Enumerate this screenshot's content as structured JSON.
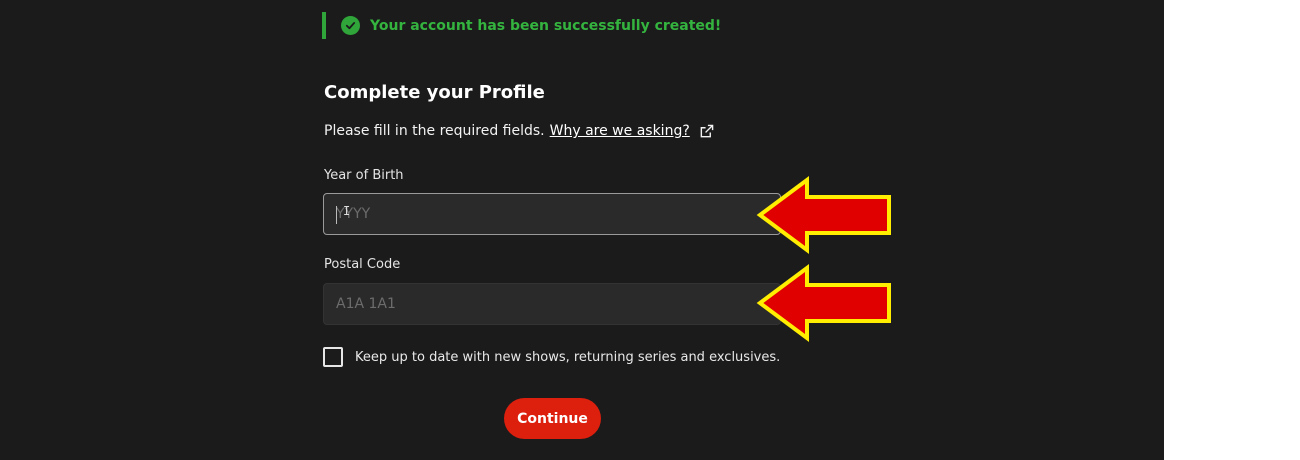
{
  "banner": {
    "text": "Your account has been successfully created!",
    "icon": "check-circle-icon",
    "color": "#2fa53a"
  },
  "form": {
    "title": "Complete your Profile",
    "subtitle": "Please fill in the required fields.",
    "help_link": "Why are we asking?",
    "year_label": "Year of Birth",
    "year_placeholder": "YYYY",
    "year_value": "",
    "postal_label": "Postal Code",
    "postal_placeholder": "A1A 1A1",
    "postal_value": "",
    "newsletter_label": "Keep up to date with new shows, returning series and exclusives.",
    "newsletter_checked": false,
    "continue_label": "Continue"
  },
  "colors": {
    "accent": "#dd1f0e",
    "success": "#2fa53a",
    "background": "#1b1b1b",
    "arrow_fill": "#e00000",
    "arrow_border": "#ffee00"
  }
}
